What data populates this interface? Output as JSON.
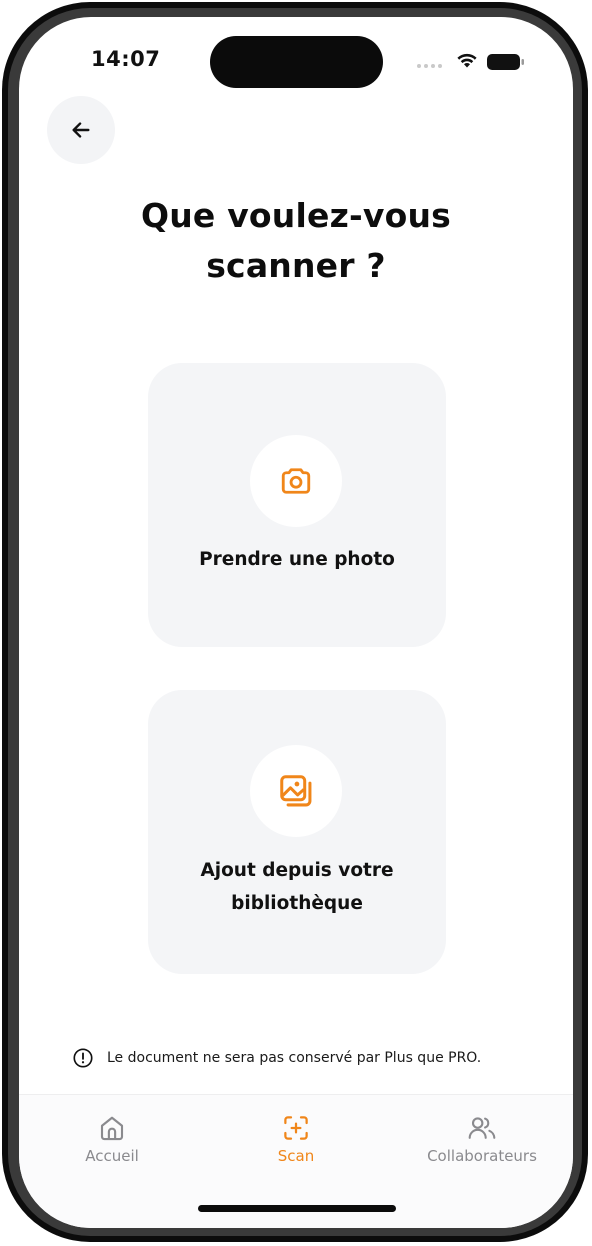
{
  "status_bar": {
    "time": "14:07"
  },
  "header": {
    "back_icon": "arrow-left-icon"
  },
  "title": {
    "line1": "Que voulez-vous",
    "line2": "scanner ?"
  },
  "options": [
    {
      "label": "Prendre une photo",
      "icon": "camera-icon"
    },
    {
      "label_line1": "Ajout depuis votre",
      "label_line2": "bibliothèque",
      "icon": "photo-library-icon"
    }
  ],
  "notice": {
    "icon": "info-circle-icon",
    "text": "Le document ne sera pas conservé par Plus que PRO."
  },
  "tabbar": {
    "tabs": [
      {
        "label": "Accueil",
        "icon": "home-icon",
        "active": false
      },
      {
        "label": "Scan",
        "icon": "scan-add-icon",
        "active": true
      },
      {
        "label": "Collaborateurs",
        "icon": "users-icon",
        "active": false
      }
    ]
  },
  "colors": {
    "accent": "#f0861a",
    "card_background": "#f4f5f7",
    "inactive_tab": "#8a8a8e"
  }
}
